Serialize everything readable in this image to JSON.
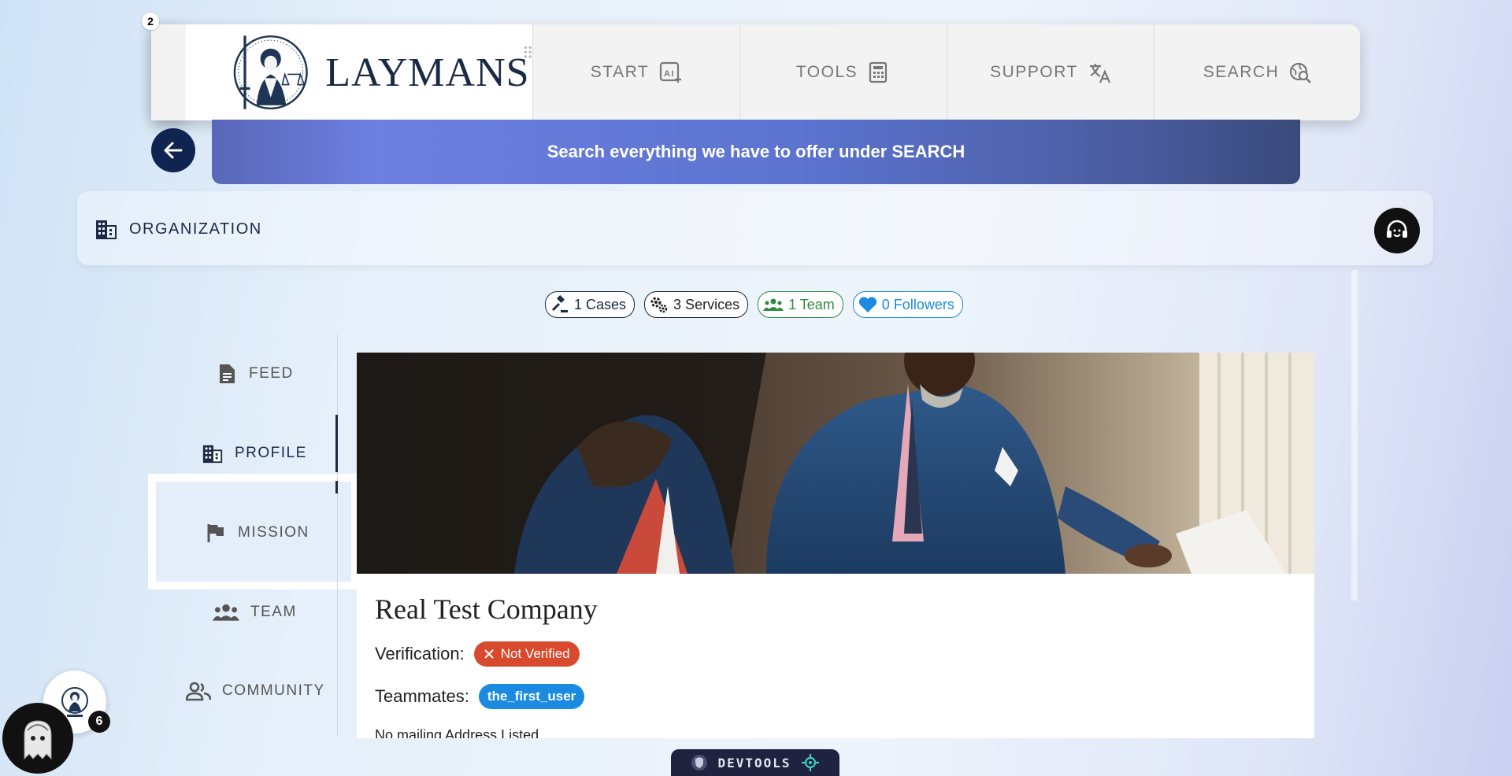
{
  "nav": {
    "badge_count": "2",
    "logo_text": "LAYMANS",
    "items": [
      {
        "label": "START",
        "icon": "ai-sparkle-icon"
      },
      {
        "label": "TOOLS",
        "icon": "calculator-icon"
      },
      {
        "label": "SUPPORT",
        "icon": "translate-icon"
      },
      {
        "label": "SEARCH",
        "icon": "search-globe-icon"
      }
    ]
  },
  "banner": {
    "text": "Search everything we have to offer under SEARCH"
  },
  "org": {
    "title": "ORGANIZATION"
  },
  "stats": {
    "cases": "1 Cases",
    "services": "3 Services",
    "team": "1 Team",
    "followers": "0 Followers"
  },
  "sidebar": {
    "items": [
      {
        "label": "FEED",
        "icon": "document-icon"
      },
      {
        "label": "PROFILE",
        "icon": "building-icon",
        "active": true
      },
      {
        "label": "MISSION",
        "icon": "flag-icon"
      },
      {
        "label": "TEAM",
        "icon": "group-icon"
      },
      {
        "label": "COMMUNITY",
        "icon": "people-icon"
      }
    ]
  },
  "profile": {
    "company_name": "Real Test Company",
    "verification_label": "Verification:",
    "verification_status": "Not Verified",
    "teammates_label": "Teammates:",
    "teammate": "the_first_user",
    "address": "No mailing Address Listed"
  },
  "widgets": {
    "notification_count": "6",
    "devtools_label": "DEVTOOLS"
  },
  "colors": {
    "navy": "#0f2450",
    "banner_start": "#5a67b8",
    "banner_end": "#394a7a",
    "not_verified": "#d84a2e",
    "teammate_pill": "#1a8be0",
    "team_chip": "#2e8b3e",
    "followers_chip": "#1a8be0"
  }
}
